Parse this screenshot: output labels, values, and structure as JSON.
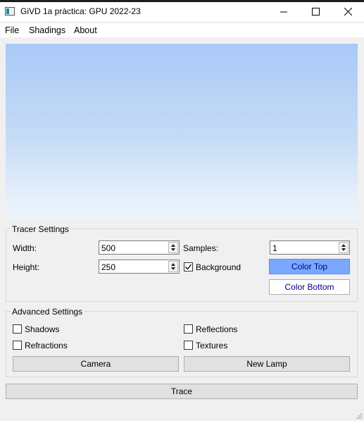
{
  "window": {
    "title": "GiVD 1a pràctica: GPU 2022-23"
  },
  "menu": {
    "items": [
      "File",
      "Shadings",
      "About"
    ]
  },
  "tracer": {
    "group_title": "Tracer Settings",
    "width_label": "Width:",
    "width_value": "500",
    "height_label": "Height:",
    "height_value": "250",
    "samples_label": "Samples:",
    "samples_value": "1",
    "background_label": "Background",
    "background_checked": true,
    "color_top_label": "Color Top",
    "color_bottom_label": "Color Bottom",
    "color_top": "#7aa8ff",
    "color_bottom": "#ffffff"
  },
  "advanced": {
    "group_title": "Advanced Settings",
    "shadows_label": "Shadows",
    "reflections_label": "Reflections",
    "refractions_label": "Refractions",
    "textures_label": "Textures",
    "camera_label": "Camera",
    "new_lamp_label": "New Lamp"
  },
  "trace_label": "Trace",
  "preview": {
    "gradient_top": "#a9c9f7",
    "gradient_bottom": "#eef4fc"
  }
}
